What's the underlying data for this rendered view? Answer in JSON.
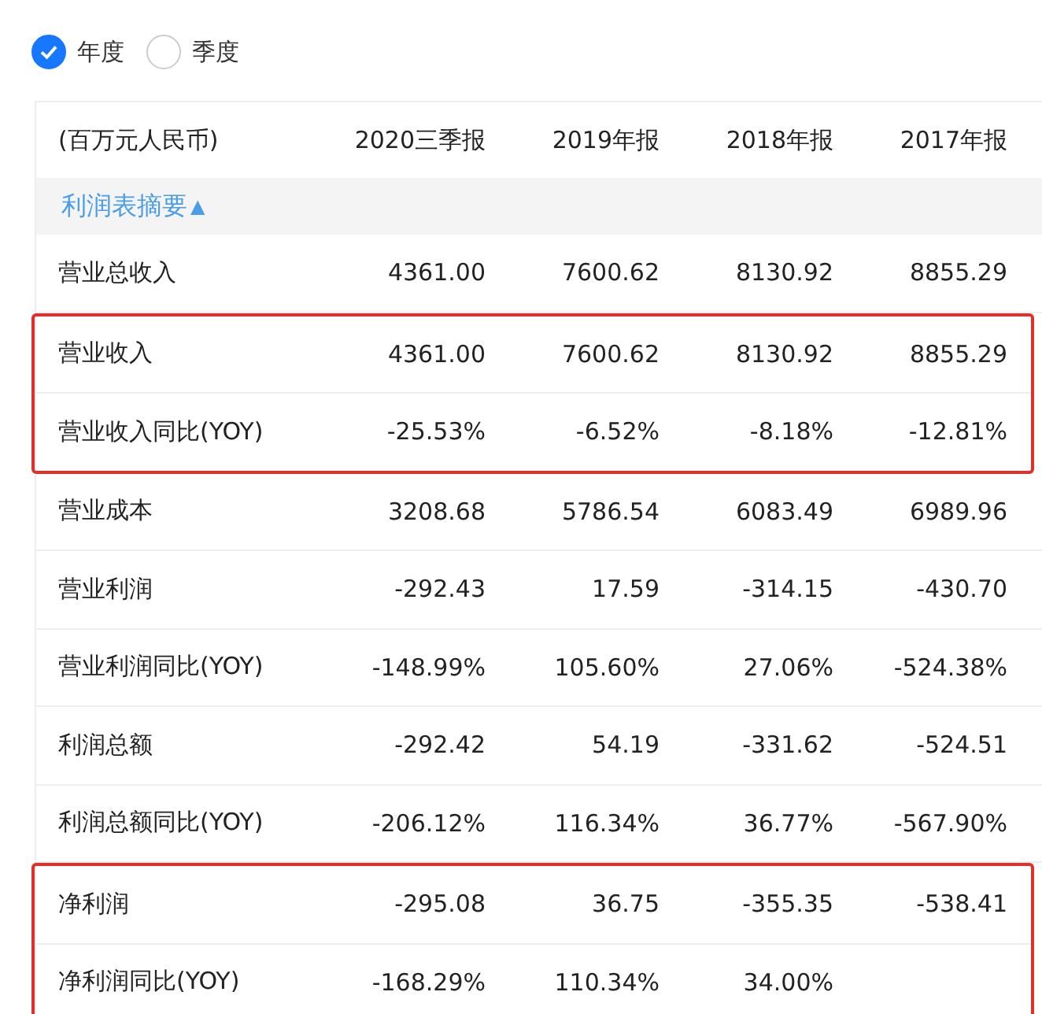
{
  "period_options": [
    {
      "label": "年度",
      "selected": true
    },
    {
      "label": "季度",
      "selected": false
    }
  ],
  "table": {
    "columns": [
      "(百万元人民币)",
      "2020三季报",
      "2019年报",
      "2018年报",
      "2017年报"
    ],
    "section": {
      "label": "利润表摘要",
      "icon": "▲",
      "expanded": true
    },
    "groups": [
      {
        "highlighted": false,
        "rows": [
          {
            "label": "营业总收入",
            "values": [
              "4361.00",
              "7600.62",
              "8130.92",
              "8855.29"
            ]
          }
        ]
      },
      {
        "highlighted": true,
        "rows": [
          {
            "label": "营业收入",
            "values": [
              "4361.00",
              "7600.62",
              "8130.92",
              "8855.29"
            ]
          },
          {
            "label": "营业收入同比(YOY)",
            "values": [
              "-25.53%",
              "-6.52%",
              "-8.18%",
              "-12.81%"
            ]
          }
        ]
      },
      {
        "highlighted": false,
        "rows": [
          {
            "label": "营业成本",
            "values": [
              "3208.68",
              "5786.54",
              "6083.49",
              "6989.96"
            ]
          },
          {
            "label": "营业利润",
            "values": [
              "-292.43",
              "17.59",
              "-314.15",
              "-430.70"
            ]
          },
          {
            "label": "营业利润同比(YOY)",
            "values": [
              "-148.99%",
              "105.60%",
              "27.06%",
              "-524.38%"
            ]
          },
          {
            "label": "利润总额",
            "values": [
              "-292.42",
              "54.19",
              "-331.62",
              "-524.51"
            ]
          },
          {
            "label": "利润总额同比(YOY)",
            "values": [
              "-206.12%",
              "116.34%",
              "36.77%",
              "-567.90%"
            ]
          }
        ]
      },
      {
        "highlighted": true,
        "rows": [
          {
            "label": "净利润",
            "values": [
              "-295.08",
              "36.75",
              "-355.35",
              "-538.41"
            ]
          },
          {
            "label": "净利润同比(YOY)",
            "values": [
              "-168.29%",
              "110.34%",
              "34.00%"
            ]
          }
        ]
      }
    ]
  }
}
